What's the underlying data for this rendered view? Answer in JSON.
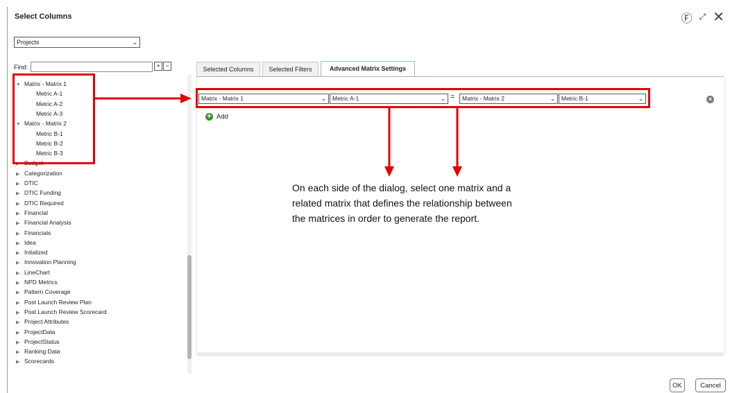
{
  "dialog": {
    "title": "Select Columns",
    "help_icon": "help-circle-icon",
    "expand_icon": "expand-arrows-icon",
    "close_icon": "close-x-icon"
  },
  "source_select": {
    "value": "Projects"
  },
  "find": {
    "label": "Find:",
    "value": ""
  },
  "tree": {
    "items": [
      {
        "label": "Matrix - Matrix 1",
        "expanded": true,
        "level": 0
      },
      {
        "label": "Metric A-1",
        "level": 1
      },
      {
        "label": "Metric A-2",
        "level": 1
      },
      {
        "label": "Metric A-3",
        "level": 1
      },
      {
        "label": "Matrix - Matrix 2",
        "expanded": true,
        "level": 0
      },
      {
        "label": "Metric B-1",
        "level": 1
      },
      {
        "label": "Metric B-2",
        "level": 1
      },
      {
        "label": "Metric B-3",
        "level": 1
      },
      {
        "label": "Budget",
        "level": 0
      },
      {
        "label": "Categorization",
        "level": 0
      },
      {
        "label": "DTIC",
        "level": 0
      },
      {
        "label": "DTIC Funding",
        "level": 0
      },
      {
        "label": "DTIC Required",
        "level": 0
      },
      {
        "label": "Financial",
        "level": 0
      },
      {
        "label": "Financial Analysis",
        "level": 0
      },
      {
        "label": "Financials",
        "level": 0
      },
      {
        "label": "Idea",
        "level": 0
      },
      {
        "label": "Initalized",
        "level": 0
      },
      {
        "label": "Innovation Planning",
        "level": 0
      },
      {
        "label": "LineChart",
        "level": 0
      },
      {
        "label": "NPD Metrics",
        "level": 0
      },
      {
        "label": "Pattern Coverage",
        "level": 0
      },
      {
        "label": "Post Launch Review Plan",
        "level": 0
      },
      {
        "label": "Post Launch Review Scorecard",
        "level": 0
      },
      {
        "label": "Project Attributes",
        "level": 0
      },
      {
        "label": "ProjectData",
        "level": 0
      },
      {
        "label": "ProjectStatus",
        "level": 0
      },
      {
        "label": "Ranking Data",
        "level": 0
      },
      {
        "label": "Scorecards",
        "level": 0
      }
    ]
  },
  "tabs": [
    {
      "label": "Selected Columns"
    },
    {
      "label": "Selected Filters"
    },
    {
      "label": "Advanced Matrix Settings",
      "active": true
    }
  ],
  "matrix_row": {
    "left_matrix": "Matrix - Matrix 1",
    "left_metric": "Metric A-1",
    "operator": "=",
    "right_matrix": "Matrix - Matrix 2",
    "right_metric": "Metric B-1"
  },
  "add": {
    "label": "Add"
  },
  "note": {
    "lines": [
      "On each side of the dialog, select one matrix and a",
      "related matrix that defines the relationship between",
      "the matrices in order to generate the report."
    ]
  },
  "footer": {
    "ok_label": "OK",
    "cancel_label": "Cancel"
  },
  "colors": {
    "annotation_red": "#e30000",
    "add_green": "#3e8e2e",
    "tree_triangle": "#6d7f96"
  }
}
